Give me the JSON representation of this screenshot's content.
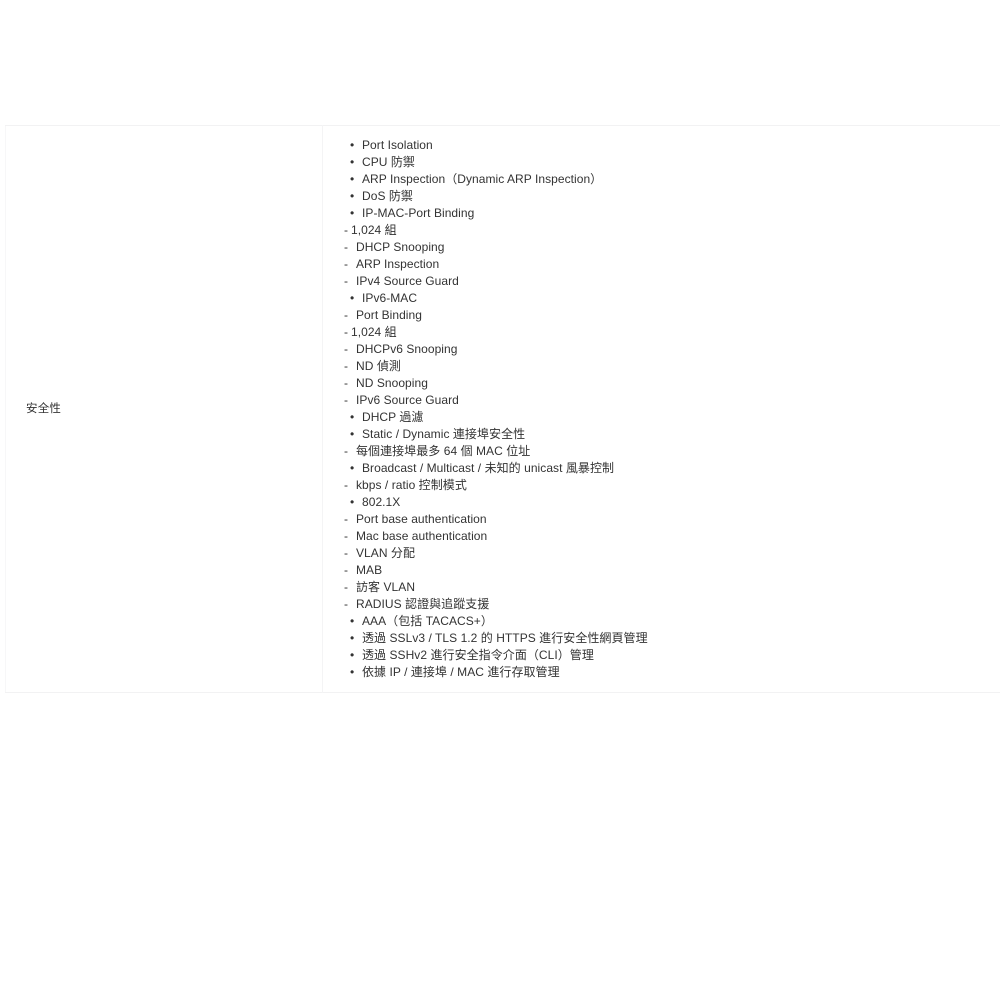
{
  "table": {
    "row": {
      "label": "安全性",
      "items": [
        {
          "marker": "•",
          "style": "bullet",
          "text": "Port Isolation"
        },
        {
          "marker": "•",
          "style": "bullet",
          "text": "CPU 防禦"
        },
        {
          "marker": "•",
          "style": "bullet",
          "text": "ARP Inspection（Dynamic ARP Inspection）"
        },
        {
          "marker": "•",
          "style": "bullet",
          "text": "DoS 防禦"
        },
        {
          "marker": "•",
          "style": "bullet",
          "text": "IP-MAC-Port Binding"
        },
        {
          "marker": "-",
          "style": "dash-tight",
          "text": "1,024 組"
        },
        {
          "marker": "-",
          "style": "dash",
          "text": "DHCP Snooping"
        },
        {
          "marker": "-",
          "style": "dash",
          "text": "ARP Inspection"
        },
        {
          "marker": "-",
          "style": "dash",
          "text": "IPv4 Source Guard"
        },
        {
          "marker": "•",
          "style": "bullet",
          "text": "IPv6-MAC"
        },
        {
          "marker": "-",
          "style": "dash",
          "text": "Port Binding"
        },
        {
          "marker": "-",
          "style": "dash-tight",
          "text": "1,024 組"
        },
        {
          "marker": "-",
          "style": "dash",
          "text": "DHCPv6 Snooping"
        },
        {
          "marker": "-",
          "style": "dash",
          "text": "ND 偵測"
        },
        {
          "marker": "-",
          "style": "dash",
          "text": "ND Snooping"
        },
        {
          "marker": "-",
          "style": "dash",
          "text": "IPv6 Source Guard"
        },
        {
          "marker": "•",
          "style": "bullet",
          "text": "DHCP 過濾"
        },
        {
          "marker": "•",
          "style": "bullet",
          "text": "Static / Dynamic 連接埠安全性"
        },
        {
          "marker": "-",
          "style": "dash",
          "text": "每個連接埠最多 64 個 MAC 位址"
        },
        {
          "marker": "•",
          "style": "bullet",
          "text": "Broadcast / Multicast / 未知的 unicast 風暴控制"
        },
        {
          "marker": "-",
          "style": "dash",
          "text": "kbps / ratio 控制模式"
        },
        {
          "marker": "•",
          "style": "bullet",
          "text": "802.1X"
        },
        {
          "marker": "-",
          "style": "dash",
          "text": "Port base authentication"
        },
        {
          "marker": "-",
          "style": "dash",
          "text": "Mac base authentication"
        },
        {
          "marker": "-",
          "style": "dash",
          "text": "VLAN 分配"
        },
        {
          "marker": "-",
          "style": "dash",
          "text": "MAB"
        },
        {
          "marker": "-",
          "style": "dash",
          "text": "訪客 VLAN"
        },
        {
          "marker": "-",
          "style": "dash",
          "text": "RADIUS 認證與追蹤支援"
        },
        {
          "marker": "•",
          "style": "bullet",
          "text": "AAA（包括 TACACS+）"
        },
        {
          "marker": "•",
          "style": "bullet",
          "text": "透過 SSLv3 / TLS 1.2 的 HTTPS 進行安全性網頁管理"
        },
        {
          "marker": "•",
          "style": "bullet",
          "text": "透過 SSHv2 進行安全指令介面（CLI）管理"
        },
        {
          "marker": "•",
          "style": "bullet",
          "text": "依據 IP / 連接埠 / MAC 進行存取管理"
        }
      ]
    }
  },
  "colors": {
    "text": "#333333",
    "border": "#f4f4f5",
    "background": "#ffffff"
  }
}
